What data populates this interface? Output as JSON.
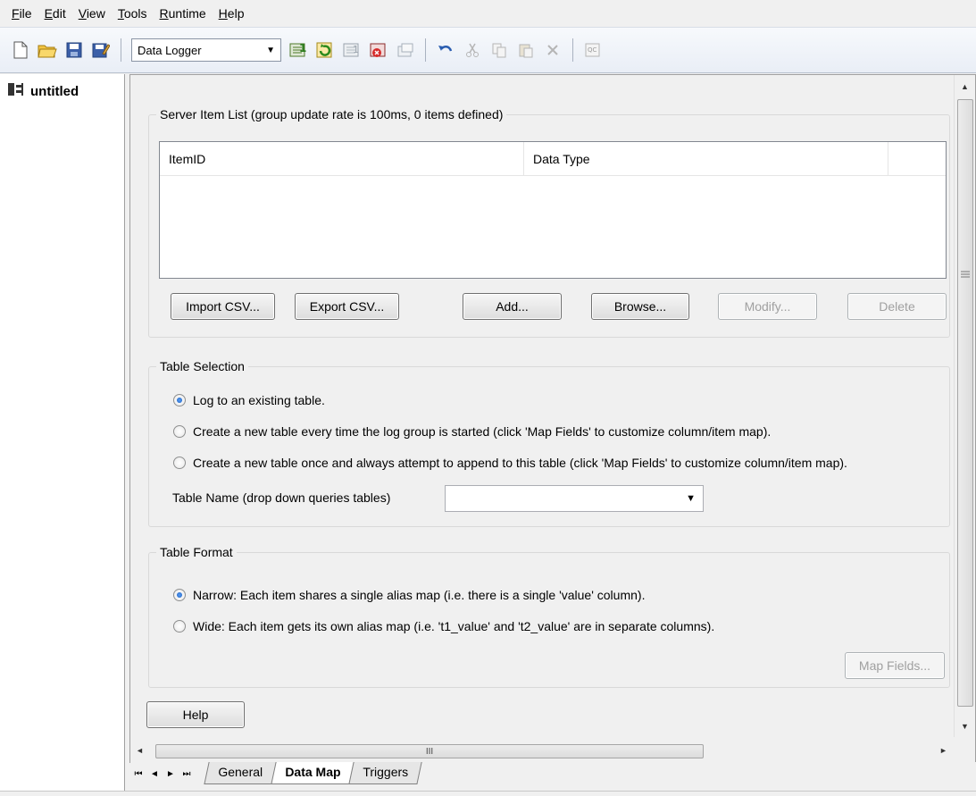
{
  "menu": [
    "File",
    "Edit",
    "View",
    "Tools",
    "Runtime",
    "Help"
  ],
  "toolbar": {
    "dropdown_value": "Data Logger",
    "icons": [
      "new-file-icon",
      "open-folder-icon",
      "save-icon",
      "save-as-icon",
      "add-group-icon",
      "enable-icon",
      "disable-icon",
      "delete-group-icon",
      "properties-icon",
      "undo-icon",
      "cut-icon",
      "copy-icon",
      "paste-icon",
      "delete-icon",
      "quick-client-icon"
    ]
  },
  "tree": {
    "root_label": "untitled"
  },
  "server_items": {
    "legend": "Server Item List (group update rate is 100ms, 0 items defined)",
    "columns": [
      "ItemID",
      "Data Type"
    ],
    "rows": [],
    "buttons": {
      "import": "Import CSV...",
      "export": "Export CSV...",
      "add": "Add...",
      "browse": "Browse...",
      "modify": "Modify...",
      "delete": "Delete"
    }
  },
  "table_selection": {
    "legend": "Table Selection",
    "options": [
      "Log to an existing table.",
      "Create a new table every time the log group is started (click 'Map Fields' to customize column/item map).",
      "Create a new table once and always attempt to append to this table (click 'Map Fields' to customize column/item map)."
    ],
    "selected_index": 0,
    "table_name_label": "Table Name (drop down queries tables)",
    "table_name_value": ""
  },
  "table_format": {
    "legend": "Table Format",
    "options": [
      "Narrow: Each item shares a single alias map (i.e. there is a single 'value' column).",
      "Wide: Each item gets its own alias map (i.e. 't1_value' and 't2_value' are in separate columns)."
    ],
    "selected_index": 0,
    "map_fields_label": "Map Fields..."
  },
  "help_label": "Help",
  "hscroll_grip": "III",
  "tabs": [
    "General",
    "Data Map",
    "Triggers"
  ],
  "active_tab": "Data Map"
}
